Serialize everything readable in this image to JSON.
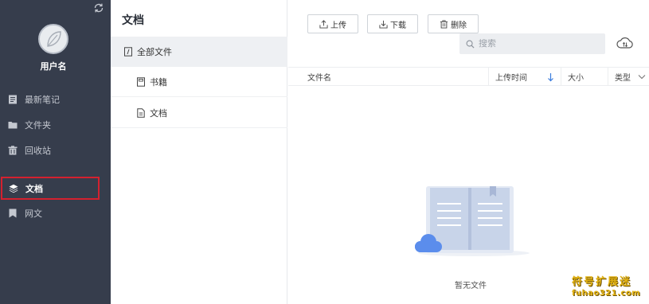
{
  "sidebar": {
    "username": "用户名",
    "items": [
      {
        "label": "最新笔记",
        "icon": "note-icon"
      },
      {
        "label": "文件夹",
        "icon": "folder-icon"
      },
      {
        "label": "回收站",
        "icon": "trash-icon"
      },
      {
        "label": "文档",
        "icon": "layers-icon",
        "active": true
      },
      {
        "label": "网文",
        "icon": "bookmark-icon"
      }
    ]
  },
  "middle": {
    "title": "文档",
    "tree": {
      "root": {
        "label": "全部文件",
        "icon": "all-files-icon"
      },
      "children": [
        {
          "label": "书籍",
          "icon": "book-icon"
        },
        {
          "label": "文档",
          "icon": "document-icon"
        }
      ]
    }
  },
  "toolbar": {
    "upload_label": "上传",
    "download_label": "下载",
    "delete_label": "删除"
  },
  "search": {
    "placeholder": "搜索"
  },
  "table": {
    "columns": {
      "name": "文件名",
      "upload_time": "上传时间",
      "size": "大小",
      "type": "类型"
    },
    "sort": "descending",
    "empty_text": "暂无文件"
  },
  "watermark": {
    "line1": "符号扩展迷",
    "line2": "fuhao321.com"
  },
  "colors": {
    "sidebar_bg": "#363d4c",
    "highlight_border": "#d4212f",
    "sort_arrow": "#3b7ddd",
    "watermark": "#e3b312"
  }
}
